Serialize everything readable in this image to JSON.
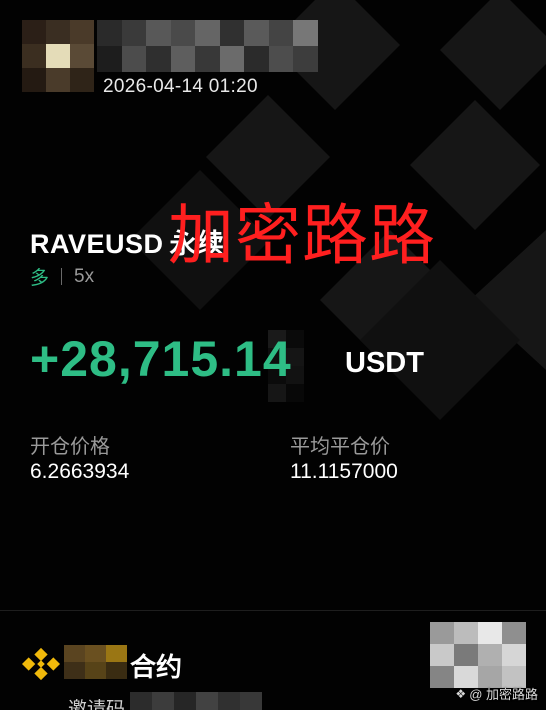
{
  "header": {
    "timestamp": "2026-04-14 01:20"
  },
  "position": {
    "symbol": "RAVEUSD",
    "type": "永续",
    "side": "多",
    "leverage": "5x",
    "pnl": "+28,715.14",
    "pnl_unit": "USDT"
  },
  "watermark": "加密路路",
  "prices": {
    "entry_label": "开仓价格",
    "entry_value": "6.2663934",
    "exit_label": "平均平仓价",
    "exit_value": "11.1157000"
  },
  "footer": {
    "contract_label": "合约",
    "invite_label": "邀请码",
    "credit": "@ 加密路路"
  },
  "colors": {
    "profit_green": "#2ebd85",
    "watermark_red": "#ff1f1f",
    "brand_yellow": "#f0b90b"
  },
  "icons": {
    "brand": "binance-logo-icon",
    "credit": "binance-small-icon"
  }
}
